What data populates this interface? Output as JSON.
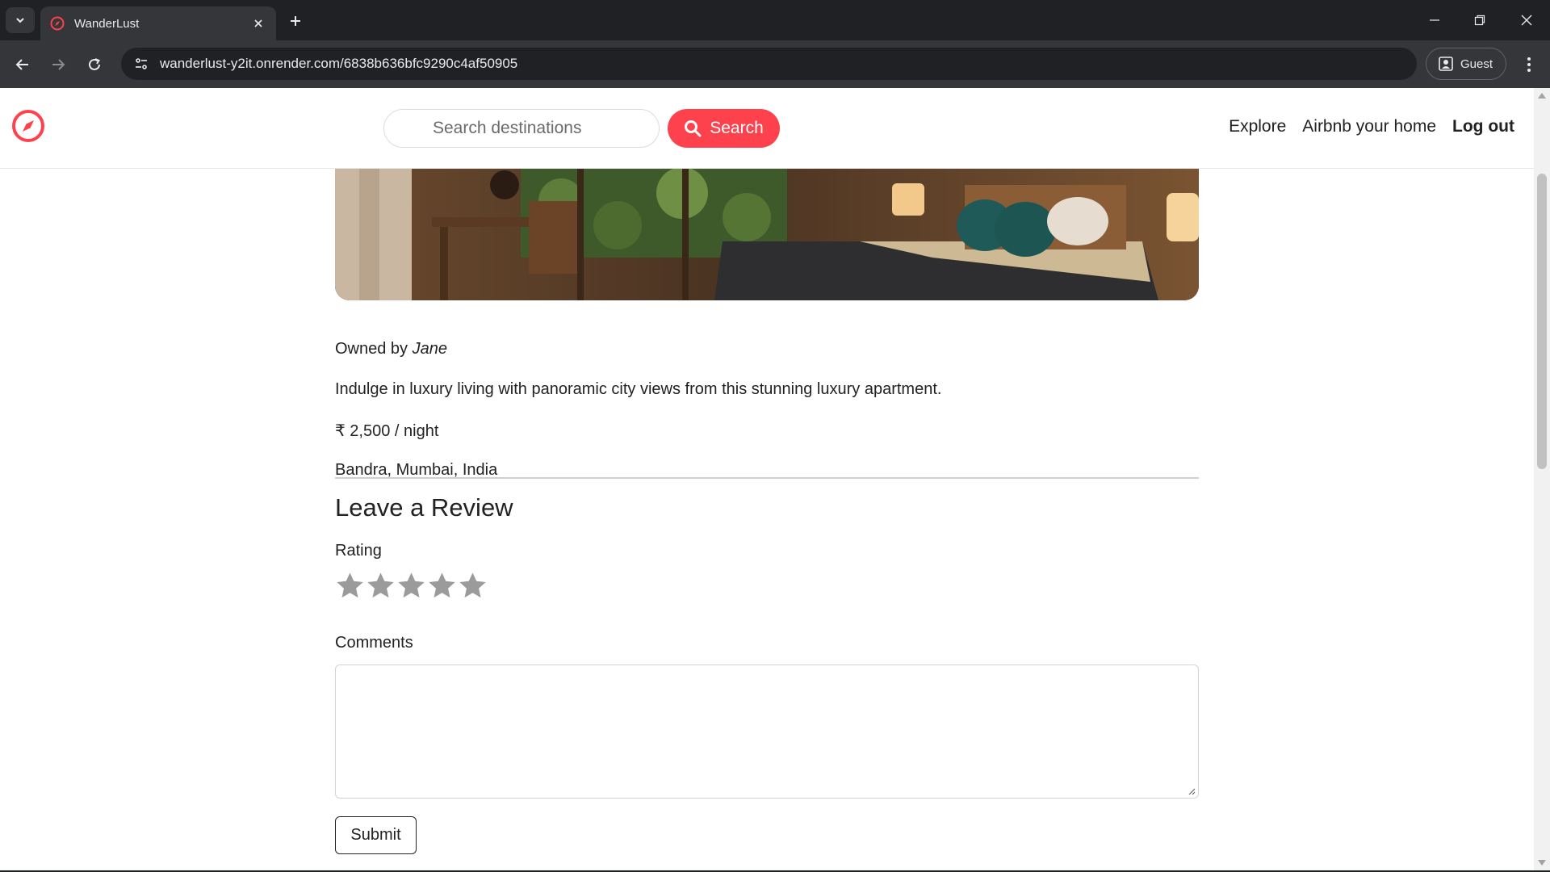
{
  "browser": {
    "tab_title": "WanderLust",
    "url": "wanderlust-y2it.onrender.com/6838b636bfc9290c4af50905",
    "profile_label": "Guest"
  },
  "site": {
    "search_placeholder": "Search destinations",
    "search_button": "Search",
    "nav_links": [
      "Explore",
      "Airbnb your home",
      "Log out"
    ],
    "brand_color": "#fe424d"
  },
  "listing": {
    "owner_prefix": "Owned by ",
    "owner_name": "Jane",
    "description": "Indulge in luxury living with panoramic city views from this stunning luxury apartment.",
    "price": "₹ 2,500 / night",
    "location": "Bandra, Mumbai, India"
  },
  "review_form": {
    "heading": "Leave a Review",
    "rating_label": "Rating",
    "rating_value": 0,
    "rating_max": 5,
    "comments_label": "Comments",
    "comments_value": "",
    "submit_label": "Submit"
  },
  "icons": [
    "compass-icon",
    "search-icon",
    "star-icon",
    "back-icon",
    "forward-icon",
    "reload-icon",
    "site-info-icon",
    "profile-icon",
    "more-icon"
  ]
}
